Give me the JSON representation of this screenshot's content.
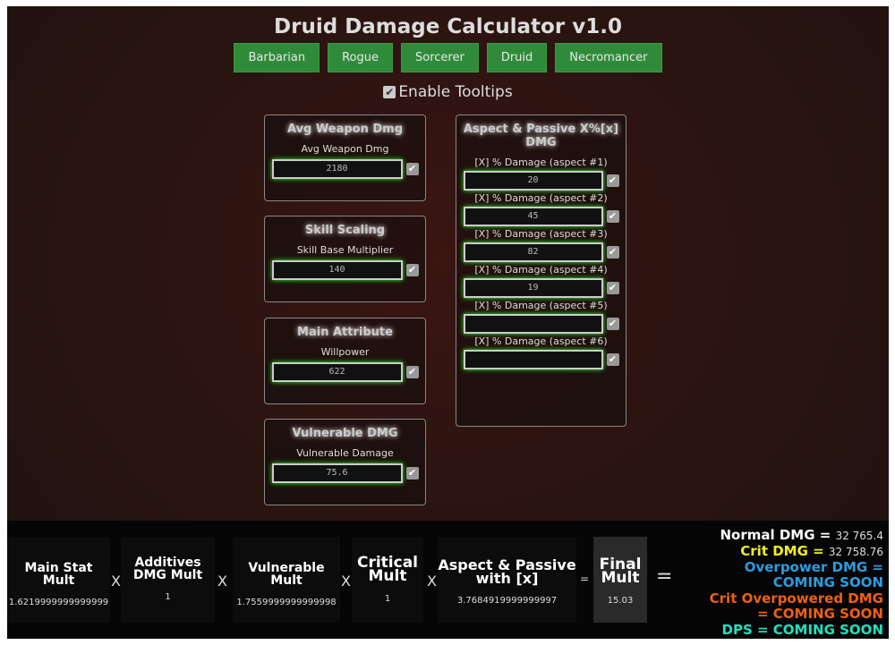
{
  "title": "Druid Damage Calculator v1.0",
  "classes": [
    "Barbarian",
    "Rogue",
    "Sorcerer",
    "Druid",
    "Necromancer"
  ],
  "tooltips": {
    "label": "Enable Tooltips",
    "checked": true
  },
  "left_boxes": [
    {
      "heading": "Avg Weapon Dmg",
      "label": "Avg Weapon Dmg",
      "value": "2180"
    },
    {
      "heading": "Skill Scaling",
      "label": "Skill Base Multiplier",
      "value": "140"
    },
    {
      "heading": "Main Attribute",
      "label": "Willpower",
      "value": "622"
    },
    {
      "heading": "Vulnerable DMG",
      "label": "Vulnerable Damage",
      "value": "75.6"
    }
  ],
  "aspect_box": {
    "heading": "Aspect & Passive X%[x] DMG",
    "fields": [
      {
        "label": "[X] % Damage (aspect #1)",
        "value": "20"
      },
      {
        "label": "[X] % Damage (aspect #2)",
        "value": "45"
      },
      {
        "label": "[X] % Damage (aspect #3)",
        "value": "82"
      },
      {
        "label": "[X] % Damage (aspect #4)",
        "value": "19"
      },
      {
        "label": "[X] % Damage (aspect #5)",
        "value": ""
      },
      {
        "label": "[X] % Damage (aspect #6)",
        "value": ""
      }
    ]
  },
  "multipliers": [
    {
      "label": "Main Stat Mult",
      "value": "1.6219999999999999"
    },
    {
      "label": "Additives DMG Mult",
      "value": "1"
    },
    {
      "label": "Vulnerable Mult",
      "value": "1.7559999999999998"
    },
    {
      "label": "Critical Mult",
      "value": "1"
    },
    {
      "label": "Aspect & Passive with [x]",
      "value": "3.7684919999999997"
    },
    {
      "label": "Final Mult",
      "value": "15.03"
    }
  ],
  "operators": {
    "times": "X",
    "equals": "="
  },
  "results": [
    {
      "label": "Normal DMG =",
      "value": "32 765.4",
      "color": "#ffffff"
    },
    {
      "label": "Crit DMG =",
      "value": "32 758.76",
      "color": "#f0f020"
    },
    {
      "label": "Overpower DMG = COMING SOON",
      "value": "",
      "color": "#2a9de0"
    },
    {
      "label": "Crit Overpowered DMG = COMING SOON",
      "value": "",
      "color": "#f06010"
    },
    {
      "label": "DPS = COMING SOON",
      "value": "",
      "color": "#20e0c0"
    }
  ]
}
